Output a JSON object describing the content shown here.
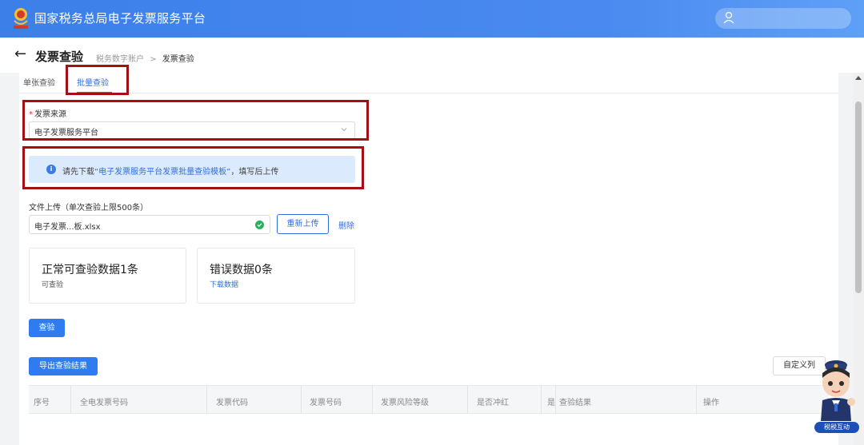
{
  "header": {
    "title": "国家税务总局电子发票服务平台"
  },
  "subheader": {
    "page_title": "发票查验",
    "breadcrumb": [
      "税务数字账户",
      "发票查验"
    ],
    "breadcrumb_sep": ">"
  },
  "tabs": [
    {
      "label": "单张查验"
    },
    {
      "label": "批量查验",
      "active": true
    }
  ],
  "form": {
    "source_required_mark": "*",
    "source_label": "发票来源",
    "source_value": "电子发票服务平台",
    "notice": {
      "prefix": "请先下载",
      "link": "“电子发票服务平台发票批量查验模板”",
      "suffix": "，填写后上传"
    },
    "upload_label": "文件上传（单次查验上限500条）",
    "file_name": "电子发票...板.xlsx",
    "reupload_label": "重新上传",
    "delete_label": "删除"
  },
  "cards": [
    {
      "title": "正常可查验数据1条",
      "sub": "可查验"
    },
    {
      "title": "错误数据0条",
      "sub": "下载数据"
    }
  ],
  "buttons": {
    "verify": "查验",
    "export": "导出查验结果",
    "custom_columns": "自定义列"
  },
  "table": {
    "columns": [
      "序号",
      "全电发票号码",
      "发票代码",
      "发票号码",
      "发票风险等级",
      "是否冲红",
      "是",
      "查验结果",
      "操作"
    ]
  },
  "mascot": {
    "badge": "税税互动"
  },
  "colors": {
    "primary": "#2f7cf0",
    "highlight": "#a30f14",
    "header": "#3c7fe9"
  }
}
